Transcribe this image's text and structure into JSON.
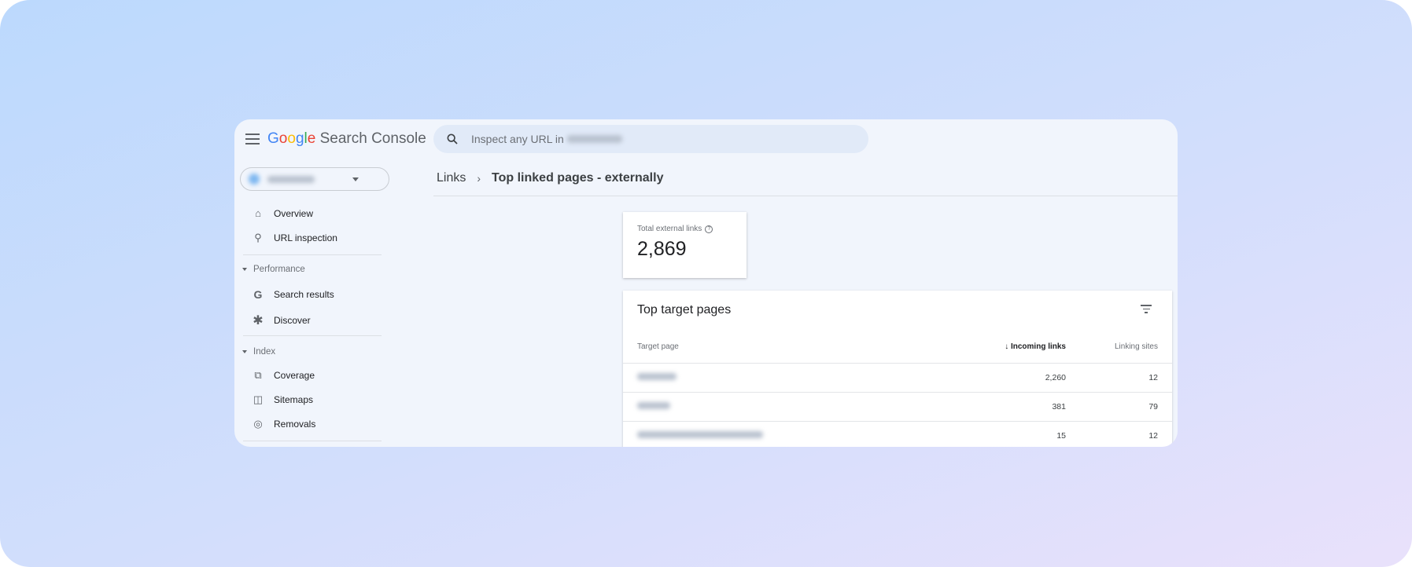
{
  "app": {
    "logo_google": "Google",
    "logo_product": "Search Console",
    "logo_colors": [
      "#4285f4",
      "#ea4335",
      "#fbbc05",
      "#4285f4",
      "#34a853",
      "#ea4335"
    ]
  },
  "search": {
    "placeholder": "Inspect any URL in",
    "icon": "search-icon"
  },
  "sidebar": {
    "items": [
      {
        "label": "Overview",
        "icon": "home-icon"
      },
      {
        "label": "URL inspection",
        "icon": "search-icon"
      }
    ],
    "sections": [
      {
        "label": "Performance",
        "items": [
          {
            "label": "Search results",
            "icon": "google-g-icon"
          },
          {
            "label": "Discover",
            "icon": "asterisk-icon"
          }
        ]
      },
      {
        "label": "Index",
        "items": [
          {
            "label": "Coverage",
            "icon": "copy-icon"
          },
          {
            "label": "Sitemaps",
            "icon": "sitemap-icon"
          },
          {
            "label": "Removals",
            "icon": "eye-off-icon"
          }
        ]
      }
    ]
  },
  "breadcrumb": {
    "parent": "Links",
    "current": "Top linked pages - externally"
  },
  "summary": {
    "label": "Total external links",
    "value": "2,869"
  },
  "table": {
    "title": "Top target pages",
    "columns": [
      "Target page",
      "Incoming links",
      "Linking sites"
    ],
    "sorted_column": "Incoming links",
    "rows": [
      {
        "incoming": "2,260",
        "sites": "12"
      },
      {
        "incoming": "381",
        "sites": "79"
      },
      {
        "incoming": "15",
        "sites": "12"
      }
    ]
  }
}
